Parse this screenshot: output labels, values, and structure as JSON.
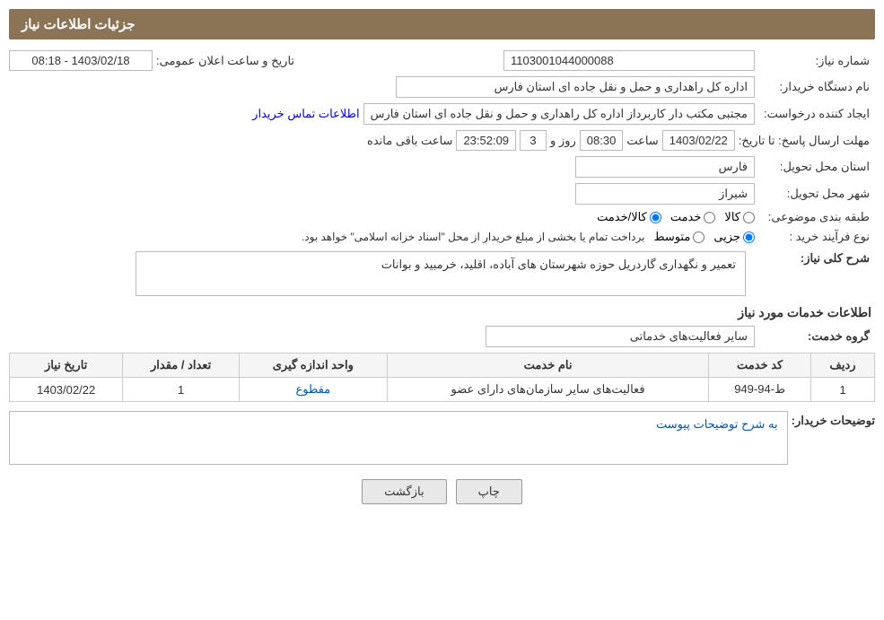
{
  "header": {
    "title": "جزئیات اطلاعات نیاز"
  },
  "fields": {
    "need_number_label": "شماره نیاز:",
    "need_number_value": "1103001044000088",
    "buyer_org_label": "نام دستگاه خریدار:",
    "buyer_org_value": "اداره کل راهداری و حمل و نقل جاده ای استان فارس",
    "creator_label": "ایجاد کننده درخواست:",
    "creator_value": "مجتبی مکتب دار کاربرداز اداره کل راهداری و حمل و نقل جاده ای استان فارس",
    "contact_link": "اطلاعات تماس خریدار",
    "announce_date_label": "تاریخ و ساعت اعلان عمومی:",
    "announce_date_value": "1403/02/18 - 08:18",
    "response_deadline_label": "مهلت ارسال پاسخ: تا تاریخ:",
    "response_date": "1403/02/22",
    "response_time_label": "ساعت",
    "response_time": "08:30",
    "response_day_label": "روز و",
    "response_days": "3",
    "response_remaining_label": "ساعت باقی مانده",
    "response_remaining": "23:52:09",
    "province_label": "استان محل تحویل:",
    "province_value": "فارس",
    "city_label": "شهر محل تحویل:",
    "city_value": "شیراز",
    "category_label": "طبقه بندی موضوعی:",
    "category_options": [
      "کالا",
      "خدمت",
      "کالا/خدمت"
    ],
    "category_selected": "کالا",
    "purchase_type_label": "نوع فرآیند خرید :",
    "purchase_types": [
      "جزیی",
      "متوسط",
      "برداخت تمام یا بخشی از مبلغ خریدار از محل \"اسناد خزانه اسلامی\" خواهد بود."
    ],
    "purchase_selected": "جزیی",
    "need_description_label": "شرح کلی نیاز:",
    "need_description": "تعمیر و نگهداری گاردریل حوزه شهرستان های آباده، اقلید، خرمبید و بوانات"
  },
  "services_section": {
    "title": "اطلاعات خدمات مورد نیاز",
    "service_group_label": "گروه خدمت:",
    "service_group_value": "سایر فعالیت‌های خدماتی",
    "table": {
      "headers": [
        "ردیف",
        "کد خدمت",
        "نام خدمت",
        "واحد اندازه گیری",
        "تعداد / مقدار",
        "تاریخ نیاز"
      ],
      "rows": [
        {
          "row": "1",
          "code": "ط-94-949",
          "name": "فعالیت‌های سایر سازمان‌های دارای عضو",
          "unit": "مقطوع",
          "quantity": "1",
          "date": "1403/02/22"
        }
      ]
    }
  },
  "buyer_notes": {
    "label": "توضیحات خریدار:",
    "text": "به شرح توضیحات پیوست"
  },
  "buttons": {
    "print": "چاپ",
    "back": "بازگشت"
  }
}
